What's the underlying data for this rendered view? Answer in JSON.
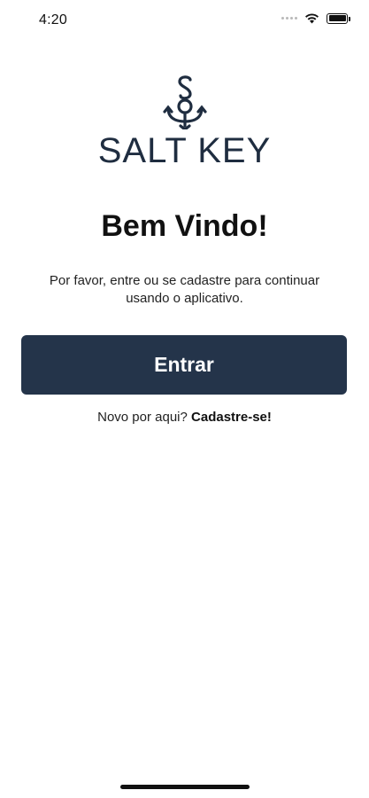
{
  "status_bar": {
    "time": "4:20",
    "icons": [
      "cellular-signal-icon",
      "wifi-icon",
      "battery-icon"
    ]
  },
  "logo": {
    "text": "SALT KEY",
    "icon": "anchor-s-logo-icon",
    "color": "#1f2d40"
  },
  "welcome": {
    "title": "Bem Vindo!",
    "subtitle": "Por favor, entre ou se cadastre para continuar usando o aplicativo."
  },
  "actions": {
    "login_label": "Entrar",
    "signup_prompt": "Novo por aqui?",
    "signup_link": "Cadastre-se!"
  },
  "colors": {
    "primary_button": "#24344a",
    "background": "#ffffff"
  }
}
